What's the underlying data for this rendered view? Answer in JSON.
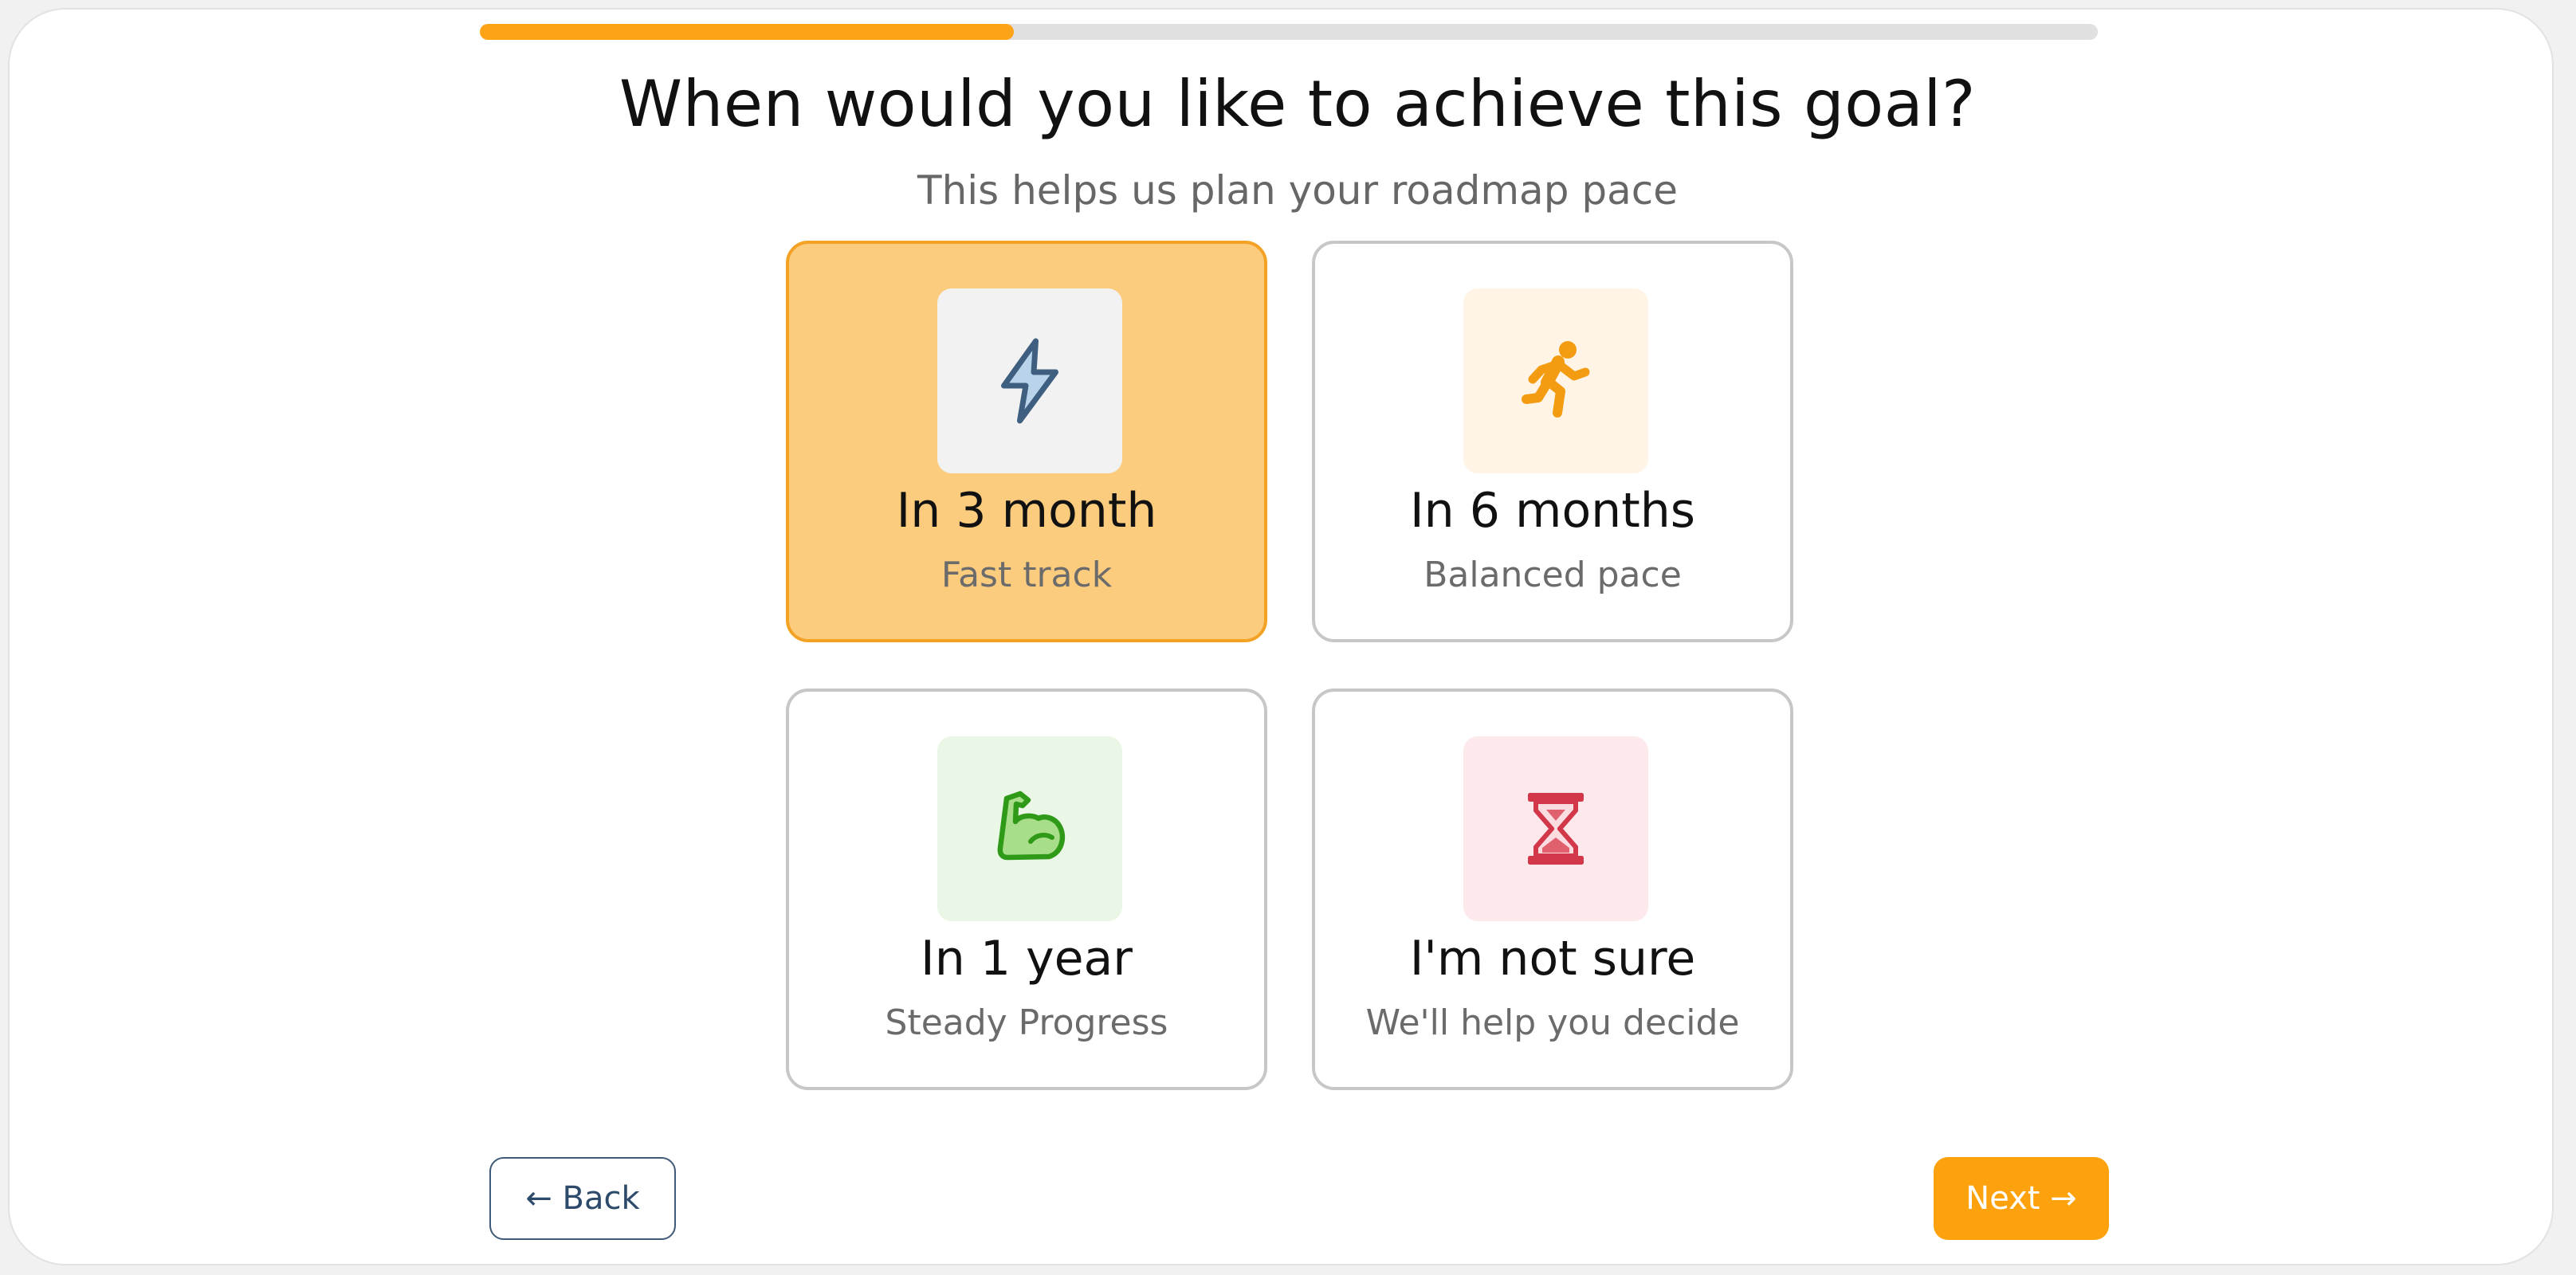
{
  "progress": {
    "value_percent": 33,
    "color": "#fda316",
    "track_color": "#e0e0e0"
  },
  "question": {
    "title": "When would you like to achieve this goal?",
    "subtitle": "This helps us plan your roadmap pace"
  },
  "options": [
    {
      "label": "In 3 month",
      "sublabel": "Fast track",
      "icon": "lightning-icon",
      "selected": true,
      "tile_color": "#f2f2f2",
      "icon_color": "#4a6b88"
    },
    {
      "label": "In 6 months",
      "sublabel": "Balanced pace",
      "icon": "running-person-icon",
      "selected": false,
      "tile_color": "#fff4e6",
      "icon_color": "#f39c12"
    },
    {
      "label": "In 1 year",
      "sublabel": "Steady Progress",
      "icon": "flexed-biceps-icon",
      "selected": false,
      "tile_color": "#eaf7e6",
      "icon_color": "#3aa81f"
    },
    {
      "label": "I'm not sure",
      "sublabel": "We'll help you decide",
      "icon": "hourglass-icon",
      "selected": false,
      "tile_color": "#fde9ec",
      "icon_color": "#d2384a"
    }
  ],
  "nav": {
    "back_label": "← Back",
    "next_label": "Next →"
  },
  "colors": {
    "accent": "#fda20c",
    "selected_card_bg": "#fbcb7e",
    "selected_card_border": "#f4a223",
    "card_border": "#c7c7c7",
    "back_button_border": "#3f5a78"
  }
}
